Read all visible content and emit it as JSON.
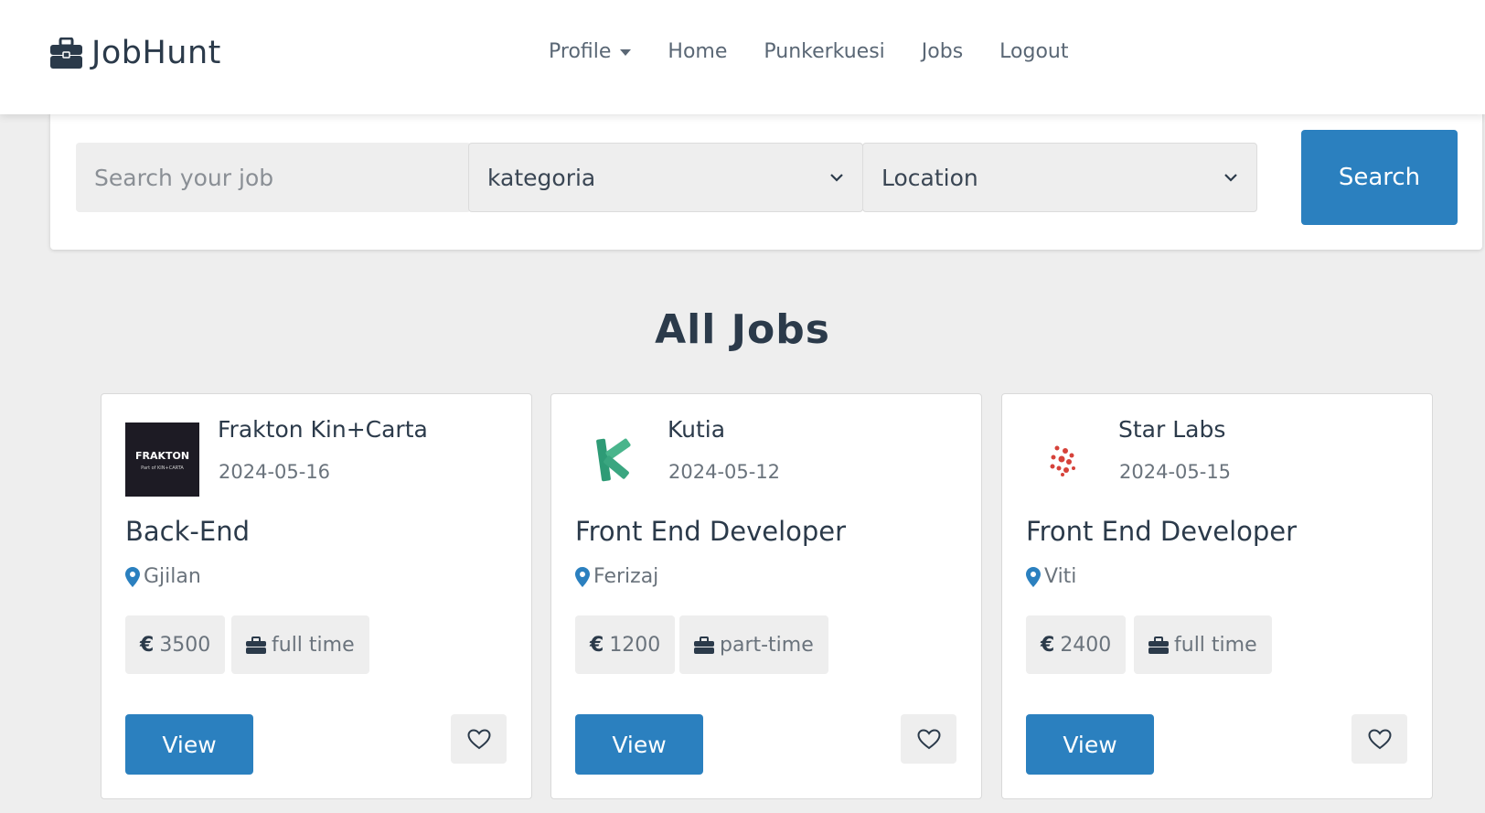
{
  "header": {
    "brand": "JobHunt",
    "brand_icon": "briefcase-icon",
    "nav": {
      "profile": "Profile",
      "home": "Home",
      "applications": "Punkerkuesi",
      "jobs": "Jobs",
      "logout": "Logout"
    }
  },
  "search": {
    "placeholder": "Search your job",
    "category": "kategoria",
    "location": "Location",
    "button": "Search"
  },
  "section_title": "All Jobs",
  "jobs": [
    {
      "company": "Frakton Kin+Carta",
      "logo_text": "FRAKTON",
      "logo_subtext": "Part of KIN+CARTA",
      "date": "2024-05-16",
      "title": "Back-End",
      "location": "Gjilan",
      "currency": "€",
      "salary": "3500",
      "type": "full time",
      "view": "View"
    },
    {
      "company": "Kutia",
      "date": "2024-05-12",
      "title": "Front End Developer",
      "location": "Ferizaj",
      "currency": "€",
      "salary": "1200",
      "type": "part-time",
      "view": "View"
    },
    {
      "company": "Star Labs",
      "date": "2024-05-15",
      "title": "Front End Developer",
      "location": "Viti",
      "currency": "€",
      "salary": "2400",
      "type": "full time",
      "view": "View"
    }
  ],
  "colors": {
    "primary": "#2b80bf",
    "background": "#eeeeee",
    "text": "#2b3a4a",
    "muted": "#6a737c"
  }
}
